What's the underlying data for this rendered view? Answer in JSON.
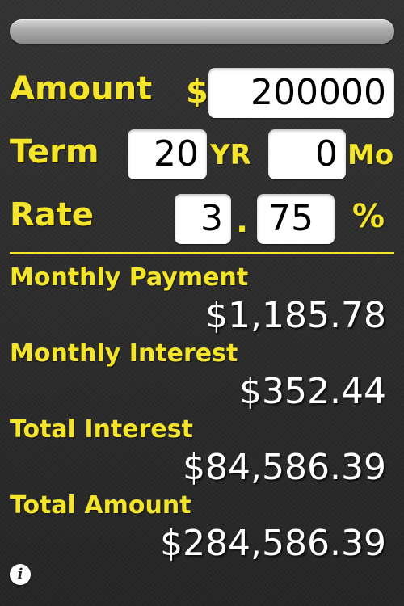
{
  "amount": {
    "label": "Amount",
    "currency": "$",
    "value": "200000"
  },
  "term": {
    "label": "Term",
    "years": "20",
    "years_unit": "YR",
    "months": "0",
    "months_unit": "Mo"
  },
  "rate": {
    "label": "Rate",
    "whole": "3",
    "separator": ".",
    "fraction": "75",
    "unit": "%"
  },
  "results": {
    "monthly_payment": {
      "label": "Monthly Payment",
      "value": "$1,185.78"
    },
    "monthly_interest": {
      "label": "Monthly Interest",
      "value": "$352.44"
    },
    "total_interest": {
      "label": "Total Interest",
      "value": "$84,586.39"
    },
    "total_amount": {
      "label": "Total Amount",
      "value": "$284,586.39"
    }
  },
  "info_button": {
    "icon": "info-icon",
    "glyph": "i"
  },
  "colors": {
    "accent": "#f5e52a",
    "background": "#2c2c2c",
    "value_text": "#ffffff"
  }
}
